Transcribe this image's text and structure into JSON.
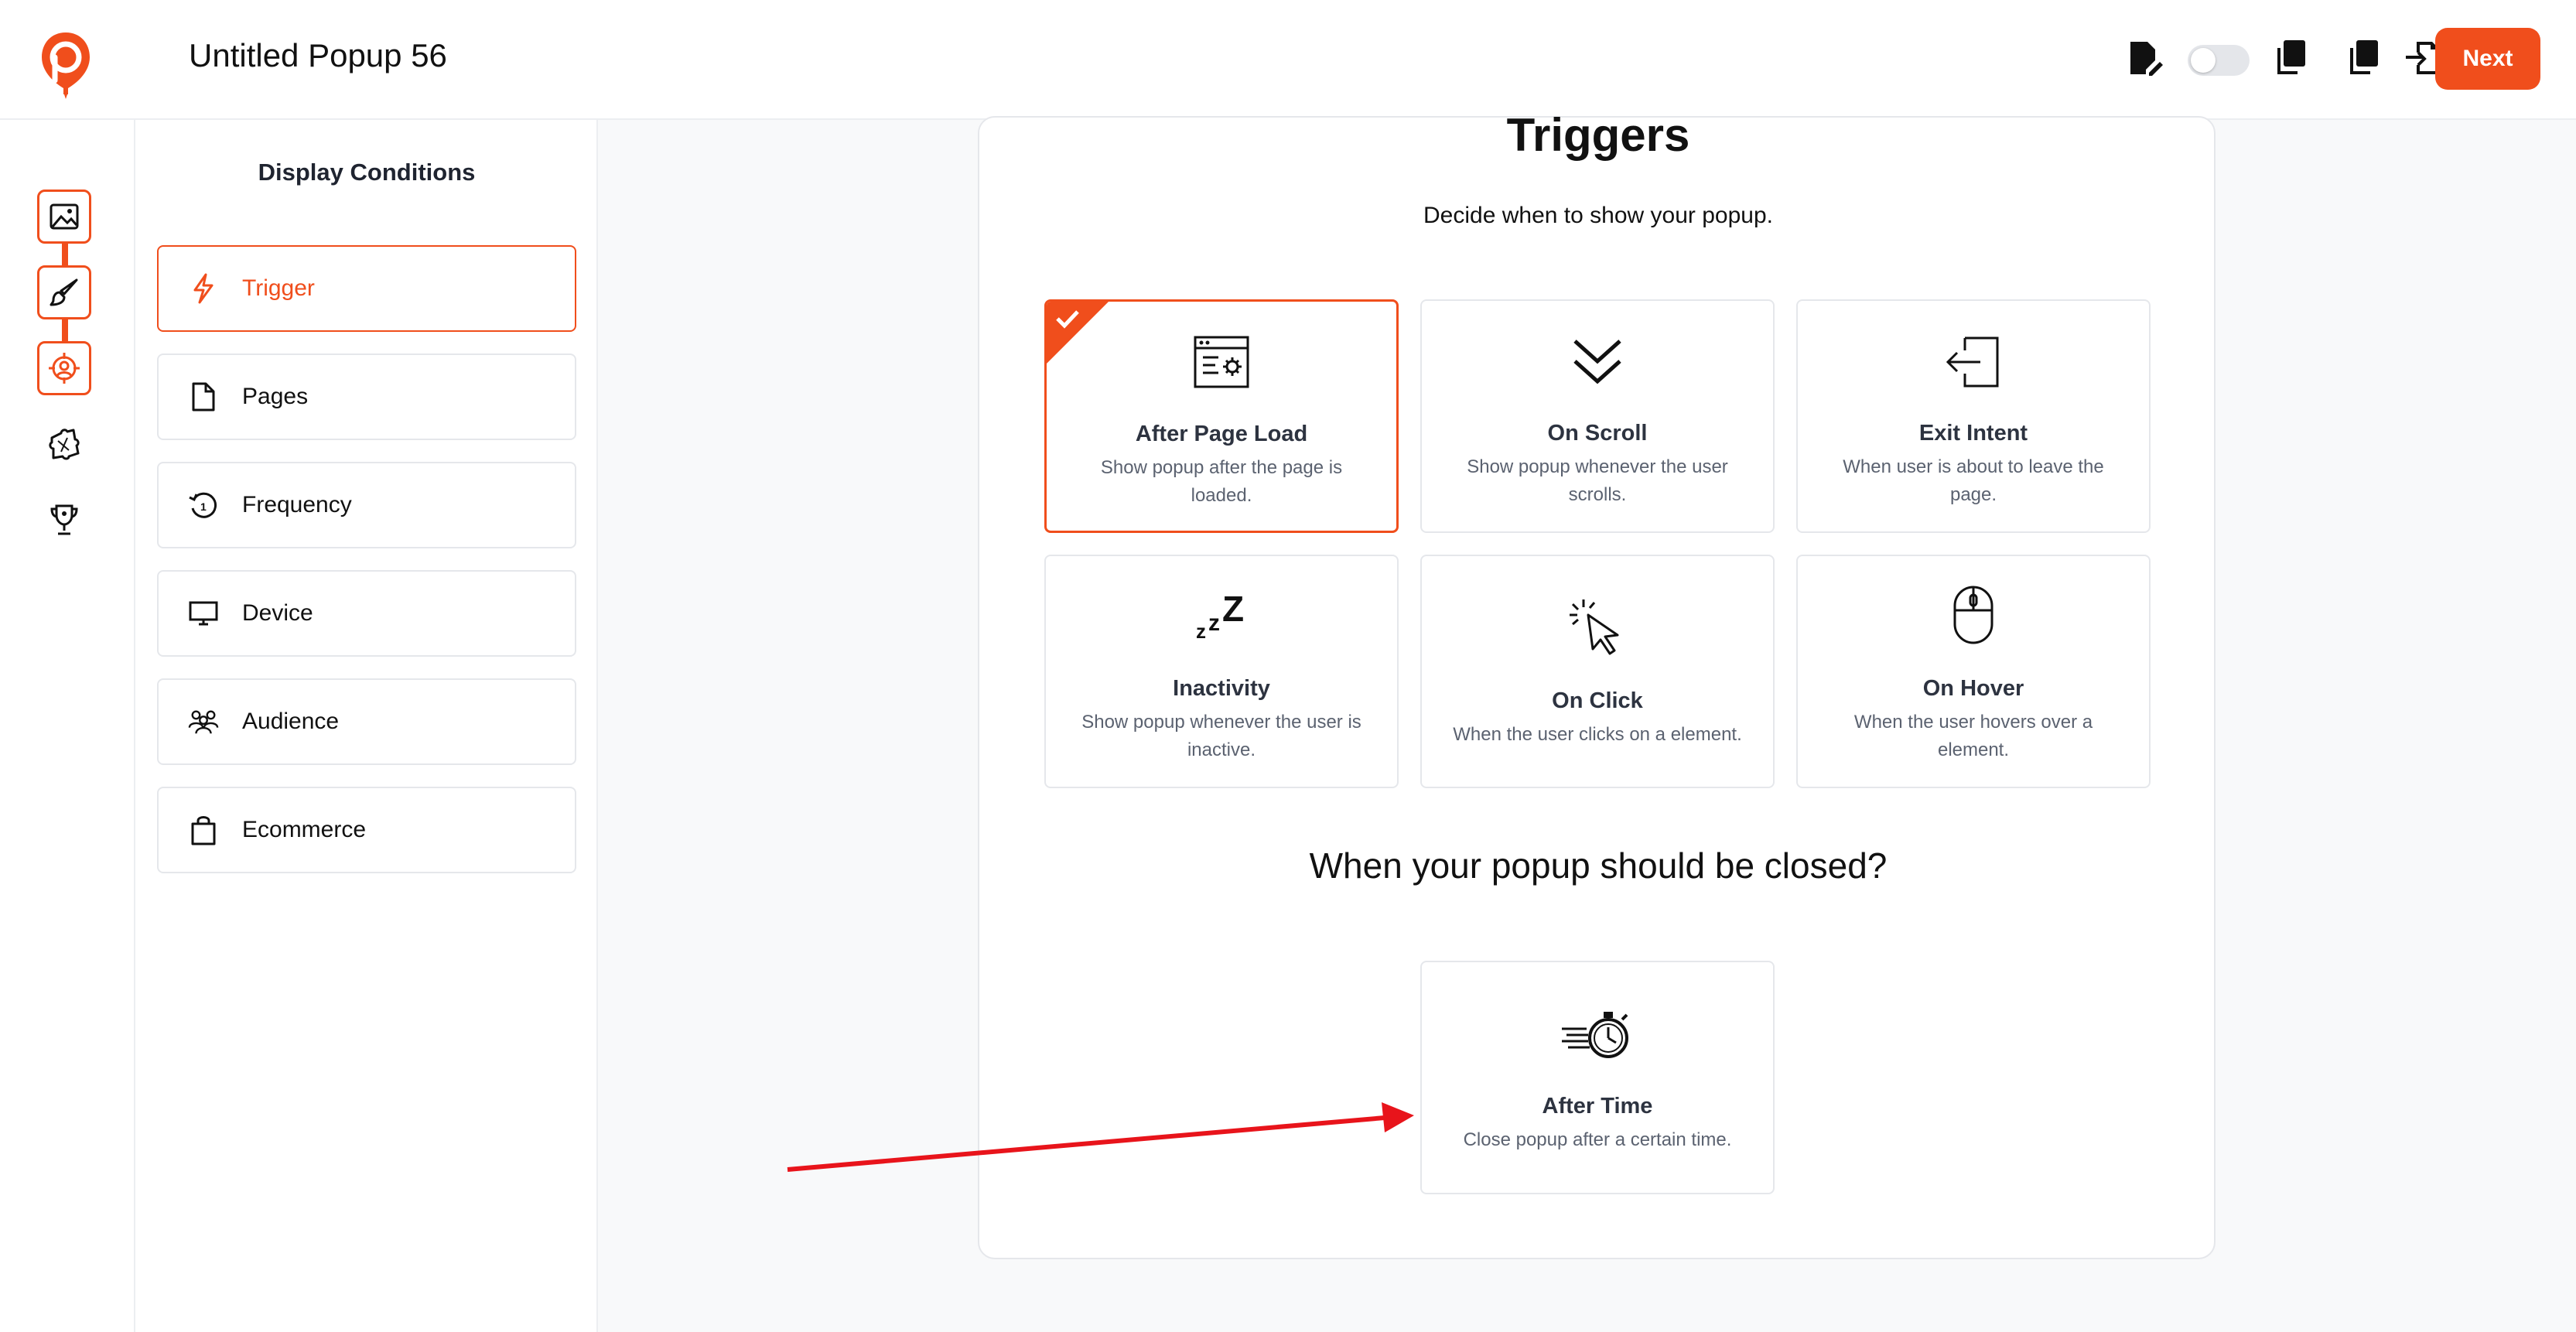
{
  "header": {
    "title": "Untitled Popup 56",
    "next_label": "Next"
  },
  "rail": {
    "items": [
      {
        "icon": "image-icon",
        "active": true
      },
      {
        "icon": "brush-icon",
        "active": true
      },
      {
        "icon": "target-icon",
        "active": true
      },
      {
        "icon": "puzzle-icon",
        "active": false
      },
      {
        "icon": "trophy-icon",
        "active": false
      }
    ]
  },
  "sidebar": {
    "title": "Display Conditions",
    "items": [
      {
        "label": "Trigger",
        "icon": "lightning-icon",
        "active": true
      },
      {
        "label": "Pages",
        "icon": "page-icon",
        "active": false
      },
      {
        "label": "Frequency",
        "icon": "history-icon",
        "active": false
      },
      {
        "label": "Device",
        "icon": "monitor-icon",
        "active": false
      },
      {
        "label": "Audience",
        "icon": "people-icon",
        "active": false
      },
      {
        "label": "Ecommerce",
        "icon": "bag-icon",
        "active": false
      }
    ]
  },
  "main": {
    "heading": "Triggers",
    "subtitle": "Decide when to show your popup.",
    "triggers": [
      {
        "title": "After Page Load",
        "desc": "Show popup after the page is loaded.",
        "selected": true,
        "icon": "browser-settings-icon"
      },
      {
        "title": "On Scroll",
        "desc": "Show popup whenever the user scrolls.",
        "selected": false,
        "icon": "chevrons-down-icon"
      },
      {
        "title": "Exit Intent",
        "desc": "When user is about to leave the page.",
        "selected": false,
        "icon": "exit-icon"
      },
      {
        "title": "Inactivity",
        "desc": "Show popup whenever the user is inactive.",
        "selected": false,
        "icon": "sleep-icon"
      },
      {
        "title": "On Click",
        "desc": "When the user clicks on a element.",
        "selected": false,
        "icon": "click-cursor-icon"
      },
      {
        "title": "On Hover",
        "desc": "When the user hovers over a element.",
        "selected": false,
        "icon": "mouse-icon"
      }
    ],
    "close_question": "When your popup should be closed?",
    "close_options": [
      {
        "title": "After Time",
        "desc": "Close popup after a certain time.",
        "icon": "stopwatch-icon"
      }
    ]
  },
  "colors": {
    "accent": "#f04e1c",
    "annotation_arrow": "#e8141b"
  }
}
